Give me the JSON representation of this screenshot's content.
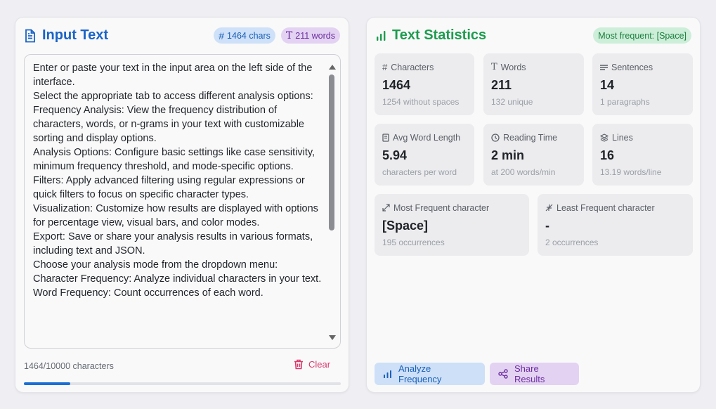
{
  "input_panel": {
    "title": "Input Text",
    "char_badge": "1464 chars",
    "word_badge": "211 words",
    "text_lines": [
      "Enter or paste your text in the input area on the left side of the interface.",
      "Select the appropriate tab to access different analysis options:",
      "Frequency Analysis: View the frequency distribution of characters, words, or n-grams in your text with customizable sorting and display options.",
      "Analysis Options: Configure basic settings like case sensitivity, minimum frequency threshold, and mode-specific options.",
      "Filters: Apply advanced filtering using regular expressions or quick filters to focus on specific character types.",
      "Visualization: Customize how results are displayed with options for percentage view, visual bars, and color modes.",
      "Export: Save or share your analysis results in various formats, including text and JSON.",
      "Choose your analysis mode from the dropdown menu:",
      "Character Frequency: Analyze individual characters in your text.",
      "Word Frequency: Count occurrences of each word."
    ],
    "char_count_label": "1464/10000 characters",
    "progress_fraction": 0.1464,
    "clear_label": "Clear"
  },
  "stats_panel": {
    "title": "Text Statistics",
    "badge": "Most frequent: [Space]",
    "tiles": [
      {
        "icon": "hash-icon",
        "label": "Characters",
        "value": "1464",
        "sub": "1254 without spaces"
      },
      {
        "icon": "text-icon",
        "label": "Words",
        "value": "211",
        "sub": "132 unique"
      },
      {
        "icon": "lines-icon",
        "label": "Sentences",
        "value": "14",
        "sub": "1 paragraphs"
      },
      {
        "icon": "book-icon",
        "label": "Avg Word Length",
        "value": "5.94",
        "sub": "characters per word"
      },
      {
        "icon": "clock-icon",
        "label": "Reading Time",
        "value": "2 min",
        "sub": "at 200 words/min"
      },
      {
        "icon": "layers-icon",
        "label": "Lines",
        "value": "16",
        "sub": "13.19 words/line"
      }
    ],
    "most_frequent": {
      "label": "Most Frequent character",
      "value": "[Space]",
      "sub": "195 occurrences"
    },
    "least_frequent": {
      "label": "Least Frequent character",
      "value": "-",
      "sub": "2 occurrences"
    },
    "analyze_label": "Analyze Frequency",
    "share_label": "Share Results"
  },
  "colors": {
    "accent_blue": "#1a63c7",
    "accent_green": "#1d9c4e",
    "clear_red": "#d93a6b",
    "share_purple": "#6b2e9f"
  }
}
